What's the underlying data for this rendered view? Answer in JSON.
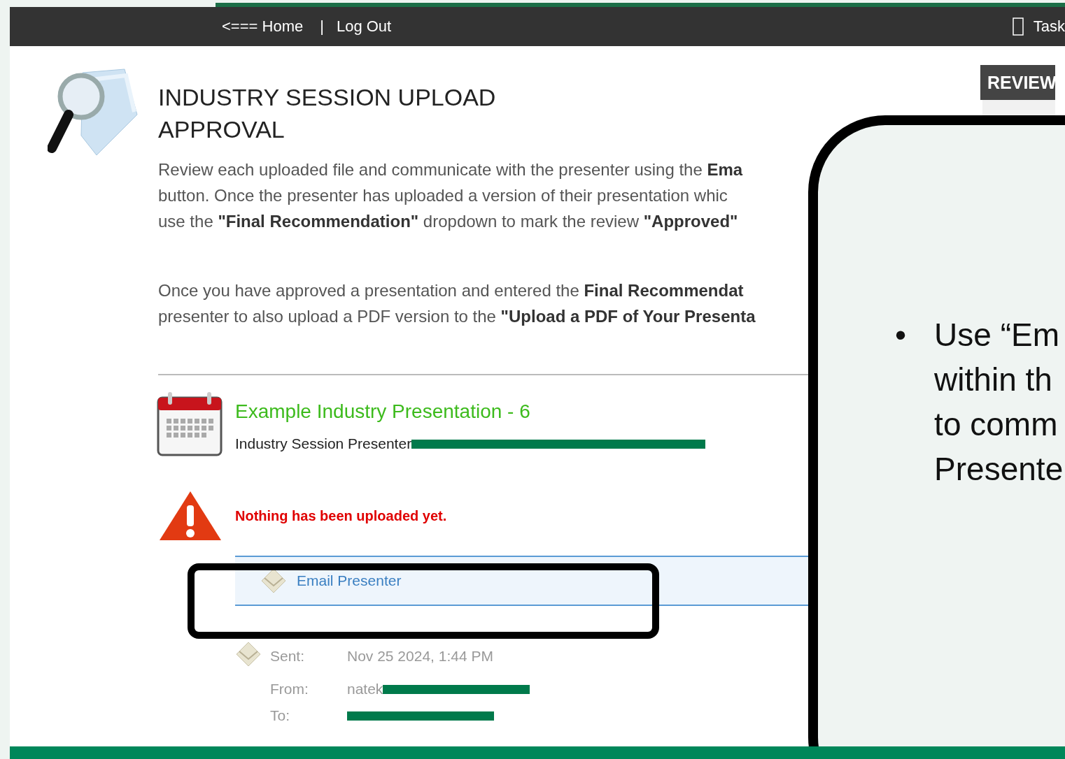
{
  "nav": {
    "links": [
      "<=== Home",
      "Log Out"
    ],
    "separator": "|",
    "right_label": "Task"
  },
  "review_panel": {
    "title": "REVIEW"
  },
  "page": {
    "title_lines": [
      "INDUSTRY SESSION UPLOAD",
      "APPROVAL"
    ],
    "paragraphs": [
      [
        "Review each uploaded file and communicate with the presenter using the **Ema**",
        "button. Once the presenter has uploaded a version of their presentation whic",
        "use the **\"Final Recommendation\"** dropdown to mark the review **\"Approved\"**"
      ],
      [
        "Once you have approved a presentation and entered the **Final Recommendat**",
        "presenter to also upload a PDF version to the **\"Upload a PDF of Your Presenta**"
      ]
    ]
  },
  "session": {
    "title": "Example Industry Presentation - 6",
    "presenter_label": "Industry Session Presenter",
    "presenter_redacted": true
  },
  "status_message": "Nothing has been uploaded yet.",
  "email_button": {
    "label": "Email Presenter",
    "highlighted": true
  },
  "email_log": [
    {
      "label": "Sent:",
      "value": "Nov 25 2024, 1:44 PM"
    },
    {
      "label": "From:",
      "value": "natek",
      "redacted": true
    },
    {
      "label": "To:",
      "redacted": true
    }
  ],
  "callout": {
    "bullet": "•",
    "lines": [
      "Use “Em",
      "within th",
      "to comm",
      "Presente"
    ]
  }
}
